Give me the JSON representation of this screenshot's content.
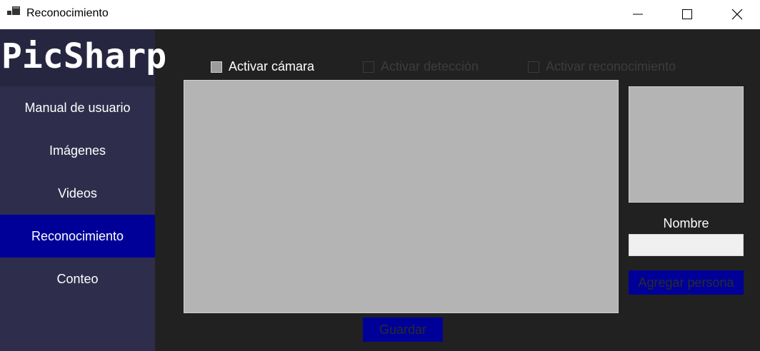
{
  "window": {
    "title": "Reconocimiento",
    "icon": "app-window-icon",
    "controls": [
      "minimize-icon",
      "maximize-icon",
      "close-icon"
    ]
  },
  "sidebar": {
    "logo": "PicSharp",
    "items": [
      {
        "label": "Manual de usuario",
        "active": false
      },
      {
        "label": "Imágenes",
        "active": false
      },
      {
        "label": "Videos",
        "active": false
      },
      {
        "label": "Reconocimiento",
        "active": true
      },
      {
        "label": "Conteo",
        "active": false
      }
    ]
  },
  "toolbar": {
    "activate_camera": {
      "label": "Activar cámara",
      "checked": false,
      "enabled": true
    },
    "activate_detection": {
      "label": "Activar detección",
      "checked": false,
      "enabled": false
    },
    "activate_recognition": {
      "label": "Activar reconocimiento",
      "checked": false,
      "enabled": false
    }
  },
  "form": {
    "name_label": "Nombre",
    "name_value": "",
    "add_person_label": "Agregar persona",
    "save_label": "Guardar"
  },
  "colors": {
    "accent": "#000099",
    "sidebar_bg": "#2e2e4c",
    "app_bg": "#212121",
    "panel_bg": "#b4b4b4"
  }
}
